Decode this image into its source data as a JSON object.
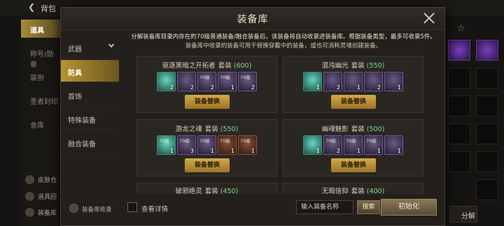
{
  "background": {
    "back_label": "背包",
    "tabs": [
      "道具",
      "称号/勋章",
      "装扮",
      "圣者封印",
      "金库"
    ],
    "bottom_items": [
      "皮肤仓",
      "道具回",
      "装备库"
    ],
    "decompose_label": "分解"
  },
  "modal": {
    "title": "装备库",
    "categories": [
      "武器",
      "防具",
      "首饰",
      "特殊装备",
      "融合装备"
    ],
    "notice": {
      "line1": "分解装备库目录内存在的70级普通装备/融合装备后，该装备将自动收录进装备库。根据装备类型，最多可收录5件。",
      "line2": "装备库中收录的装备可用于替换穿戴中的装备，或也可消耗灵魂创建装备。"
    },
    "set_label": "套装",
    "swap_label": "装备替换",
    "sets": [
      {
        "name": "驱逐黑暗之开拓者",
        "count": "(600)",
        "icons": [
          {
            "type": "green",
            "level": "",
            "qty": "2",
            "name": "green-armor-icon"
          },
          {
            "type": "purple",
            "level": "",
            "qty": "2",
            "name": "purple-armor-icon"
          },
          {
            "type": "purple",
            "level": "70级",
            "qty": "2",
            "name": "purple-armor-icon"
          },
          {
            "type": "purple",
            "level": "70级",
            "qty": "1",
            "name": "purple-armor-icon"
          },
          {
            "type": "purple",
            "level": "70级",
            "qty": "2",
            "name": "purple-armor-icon"
          }
        ]
      },
      {
        "name": "混沌幽光",
        "count": "(550)",
        "icons": [
          {
            "type": "green",
            "level": "",
            "qty": "1",
            "name": "green-armor-icon"
          },
          {
            "type": "purple",
            "level": "",
            "qty": "2",
            "name": "purple-armor-icon"
          },
          {
            "type": "purple",
            "level": "",
            "qty": "1",
            "name": "purple-armor-icon"
          },
          {
            "type": "purple",
            "level": "",
            "qty": "2",
            "name": "purple-armor-icon"
          },
          {
            "type": "purple",
            "level": "",
            "qty": "1",
            "name": "purple-armor-icon"
          }
        ]
      },
      {
        "name": "游龙之魂",
        "count": "(550)",
        "icons": [
          {
            "type": "green",
            "level": "70级",
            "qty": "1",
            "name": "green-armor-icon"
          },
          {
            "type": "purple",
            "level": "70级",
            "qty": "3",
            "name": "purple-armor-icon"
          },
          {
            "type": "purple",
            "level": "70级",
            "qty": "1",
            "name": "purple-armor-icon"
          },
          {
            "type": "red",
            "level": "70级",
            "qty": "1",
            "name": "red-armor-icon"
          },
          {
            "type": "red",
            "level": "70级",
            "qty": "1",
            "name": "red-armor-icon"
          }
        ]
      },
      {
        "name": "幽魂魅影",
        "count": "(500)",
        "icons": [
          {
            "type": "green",
            "level": "",
            "qty": "1",
            "name": "green-armor-icon"
          },
          {
            "type": "purple",
            "level": "70级",
            "qty": "2",
            "name": "purple-armor-icon"
          },
          {
            "type": "purple",
            "level": "70级",
            "qty": "1",
            "name": "purple-armor-icon"
          },
          {
            "type": "purple",
            "level": "70级",
            "qty": "1",
            "name": "purple-armor-icon"
          },
          {
            "type": "purple",
            "level": "",
            "qty": "1",
            "name": "purple-armor-icon"
          }
        ]
      },
      {
        "name": "破邪绝灵",
        "count": "(450)"
      },
      {
        "name": "无瑕信仰",
        "count": "(400)"
      }
    ],
    "recycle_label": "装备库收录",
    "check_label": "查看详情",
    "search_placeholder": "输入装备名称",
    "search_button": "搜索",
    "init_button": "初始化"
  }
}
